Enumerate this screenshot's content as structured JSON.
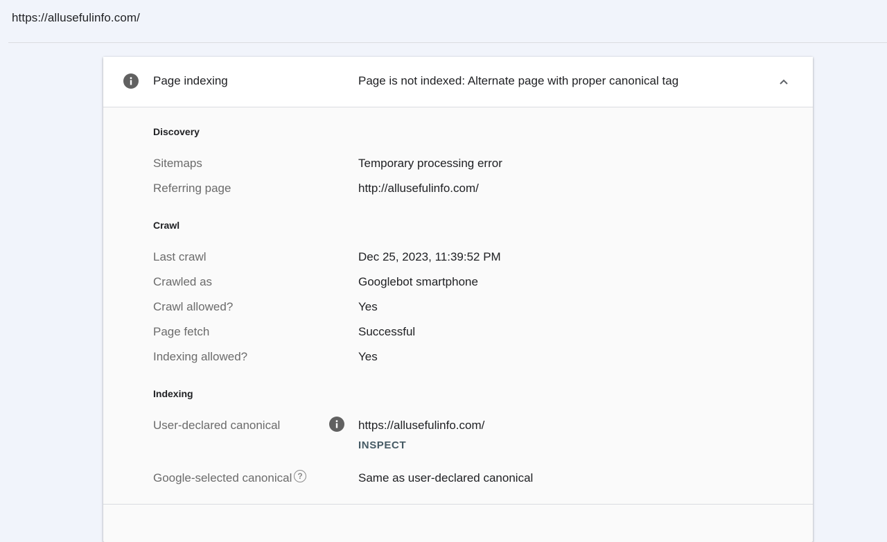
{
  "url": "https://allusefulinfo.com/",
  "panel": {
    "title": "Page indexing",
    "status": "Page is not indexed: Alternate page with proper canonical tag",
    "icon": "info-icon",
    "collapse_icon": "chevron-up-icon"
  },
  "discovery": {
    "title": "Discovery",
    "sitemaps_label": "Sitemaps",
    "sitemaps_value": "Temporary processing error",
    "referring_label": "Referring page",
    "referring_value": "http://allusefulinfo.com/"
  },
  "crawl": {
    "title": "Crawl",
    "last_crawl_label": "Last crawl",
    "last_crawl_value": "Dec 25, 2023, 11:39:52 PM",
    "crawled_as_label": "Crawled as",
    "crawled_as_value": "Googlebot smartphone",
    "crawl_allowed_label": "Crawl allowed?",
    "crawl_allowed_value": "Yes",
    "page_fetch_label": "Page fetch",
    "page_fetch_value": "Successful",
    "indexing_allowed_label": "Indexing allowed?",
    "indexing_allowed_value": "Yes"
  },
  "indexing": {
    "title": "Indexing",
    "user_canonical_label": "User-declared canonical",
    "user_canonical_value": "https://allusefulinfo.com/",
    "inspect_label": "INSPECT",
    "google_canonical_label": "Google-selected canonical",
    "google_canonical_value": "Same as user-declared canonical",
    "help_glyph": "?"
  }
}
